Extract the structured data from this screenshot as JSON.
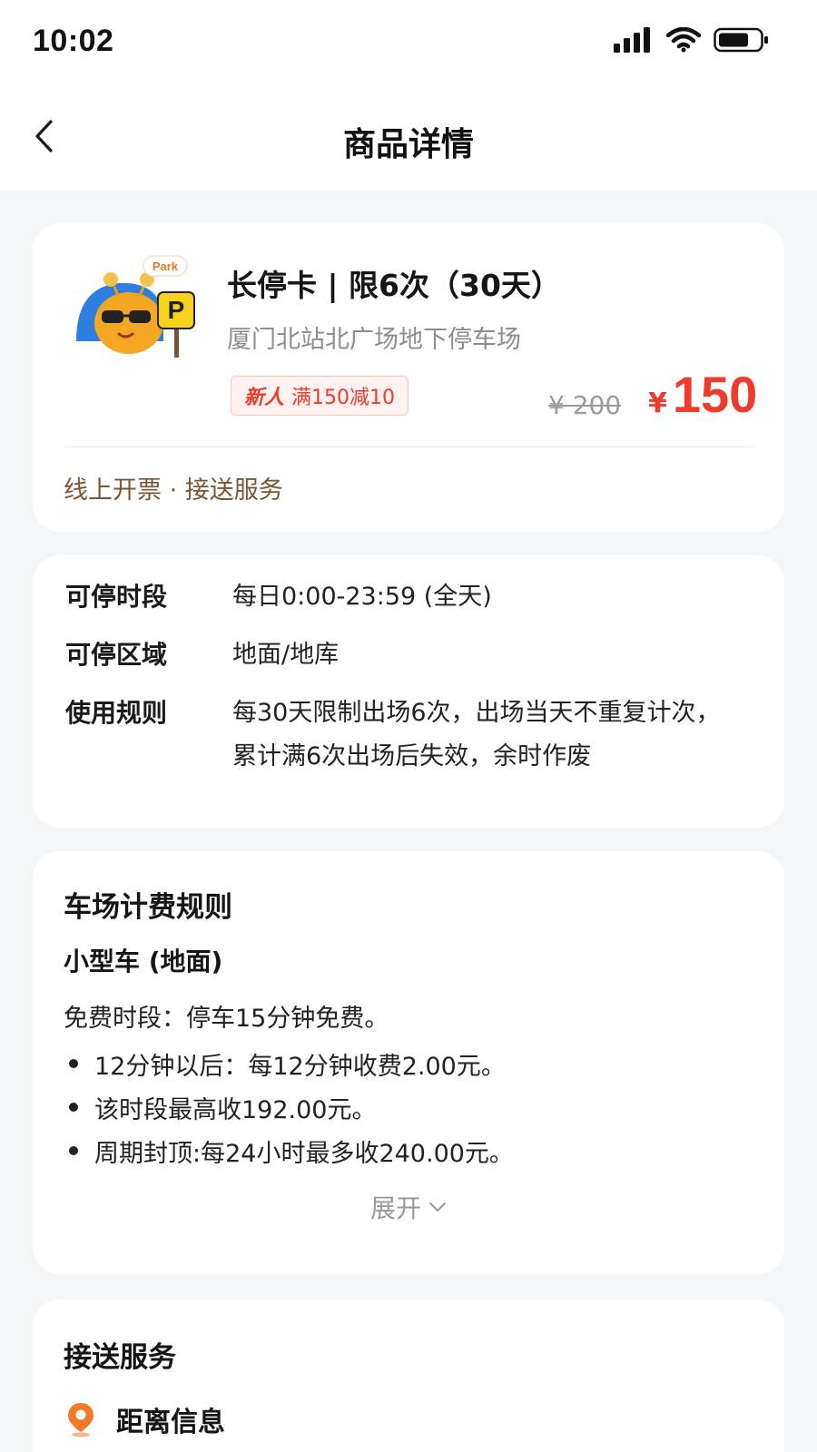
{
  "status_bar": {
    "time": "10:02"
  },
  "nav": {
    "title": "商品详情"
  },
  "product": {
    "title": "长停卡 | 限6次（30天）",
    "location": "厦门北站北广场地下停车场",
    "image_badge": "Park",
    "image_sign": "P",
    "promo_new": "新人",
    "promo_text": "满150减10",
    "price_original": "¥ 200",
    "price_currency": "¥",
    "price_current": "150",
    "services": "线上开票 · 接送服务"
  },
  "details": {
    "rows": [
      {
        "label": "可停时段",
        "value": "每日0:00-23:59 (全天)"
      },
      {
        "label": "可停区域",
        "value": "地面/地库"
      },
      {
        "label": "使用规则",
        "value": "每30天限制出场6次，出场当天不重复计次，累计满6次出场后失效，余时作废"
      }
    ]
  },
  "billing": {
    "title": "车场计费规则",
    "subtitle": "小型车 (地面)",
    "free_period": "免费时段：停车15分钟免费。",
    "rules": [
      "12分钟以后：每12分钟收费2.00元。",
      "该时段最高收192.00元。",
      "周期封顶:每24小时最多收240.00元。"
    ],
    "expand_label": "展开"
  },
  "shuttle": {
    "title": "接送服务",
    "distance_label": "距离信息"
  },
  "colors": {
    "accent_red": "#ee3b2b",
    "service_brown": "#7a5535",
    "location_orange": "#f47a2a"
  }
}
